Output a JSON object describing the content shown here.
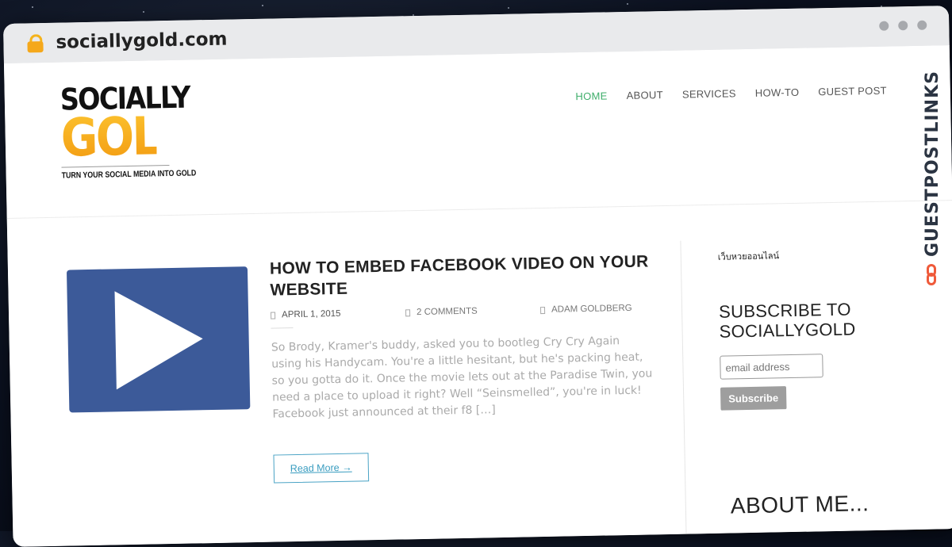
{
  "browser": {
    "url": "sociallygold.com"
  },
  "logo": {
    "line1": "SOCIALLY",
    "line2": "GOLD",
    "tagline": "TURN YOUR SOCIAL MEDIA INTO GOLD"
  },
  "nav": {
    "items": [
      {
        "label": "HOME",
        "active": true
      },
      {
        "label": "ABOUT"
      },
      {
        "label": "SERVICES"
      },
      {
        "label": "HOW-TO"
      },
      {
        "label": "GUEST POST"
      }
    ]
  },
  "post": {
    "title": "HOW TO EMBED FACEBOOK VIDEO ON YOUR WEBSITE",
    "date": "APRIL 1, 2015",
    "comments": "2 COMMENTS",
    "author": "ADAM GOLDBERG",
    "excerpt": "So Brody, Kramer's buddy, asked you to bootleg Cry Cry Again using his Handycam. You're a little hesitant, but he's packing heat, so you gotta do it. Once the movie lets out at the Paradise Twin, you need a place to upload it right? Well “Seinsmelled”, you're in luck! Facebook just announced at their f8 […]",
    "read_more": "Read More →",
    "thumb_color": "#3c5a99"
  },
  "sidebar": {
    "thai_text": "เว็บหวยออนไลน์",
    "subscribe_title": "SUBSCRIBE TO SOCIALLYGOLD",
    "email_placeholder": "email address",
    "subscribe_button": "Subscribe",
    "about_title": "ABOUT ME..."
  },
  "watermark": {
    "text": "GUESTPOSTLINKS"
  },
  "colors": {
    "nav_active": "#3fae6b",
    "read_more": "#3a9dc0",
    "logo_gold": "#f6a623",
    "watermark_accent": "#ef5a3a"
  }
}
